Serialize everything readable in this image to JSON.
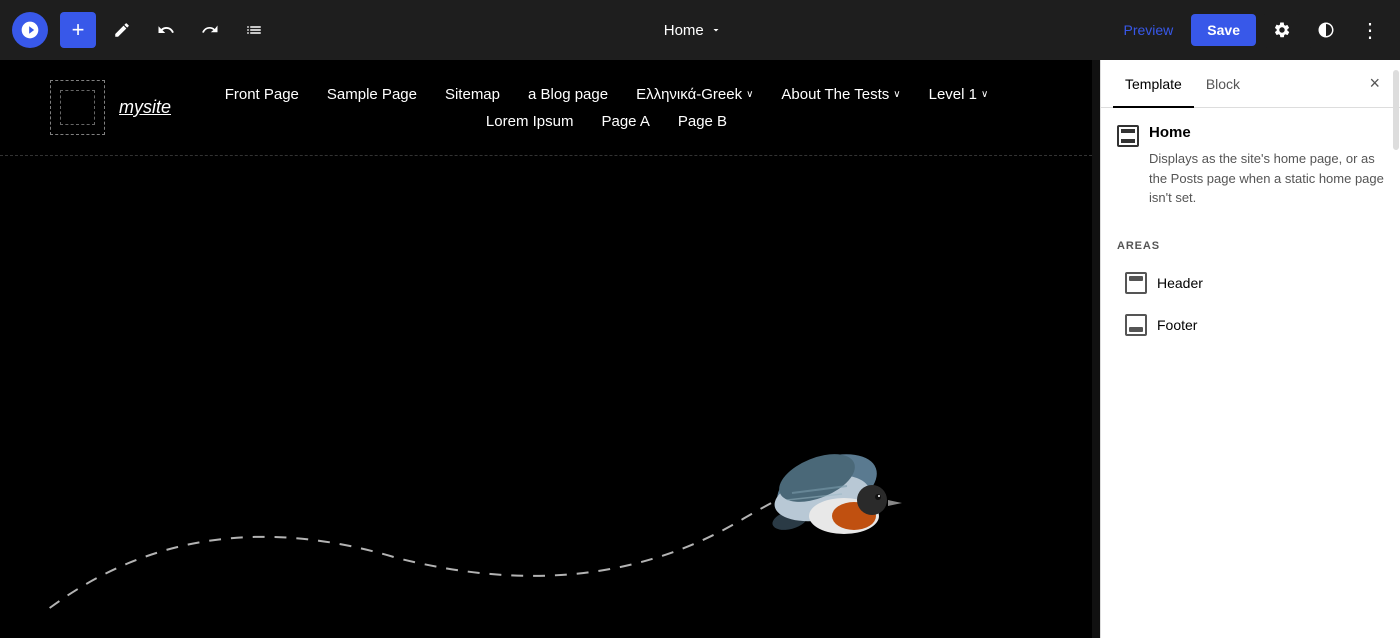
{
  "topbar": {
    "plus_label": "+",
    "undo_label": "↺",
    "redo_label": "↻",
    "list_label": "≡",
    "page_selector": "Home",
    "chevron": "∨",
    "preview_label": "Preview",
    "save_label": "Save",
    "settings_icon": "⚙",
    "contrast_icon": "◑",
    "more_icon": "⋮"
  },
  "panel": {
    "tab_template": "Template",
    "tab_block": "Block",
    "close_label": "×",
    "section_title": "Home",
    "description": "Displays as the site's home page, or as the Posts page when a static home page isn't set.",
    "areas_label": "AREAS",
    "area_header": "Header",
    "area_footer": "Footer"
  },
  "canvas": {
    "site_name": "mysite",
    "nav_row1": [
      "Front Page",
      "Sample Page",
      "Sitemap",
      "a Blog page",
      "Ελληνικά-Greek",
      "About The Tests",
      "Level 1"
    ],
    "nav_row2": [
      "Lorem Ipsum",
      "Page A",
      "Page B"
    ],
    "dropdown_items": [
      "Ελληνικά-Greek",
      "About The Tests",
      "Level 1"
    ]
  }
}
